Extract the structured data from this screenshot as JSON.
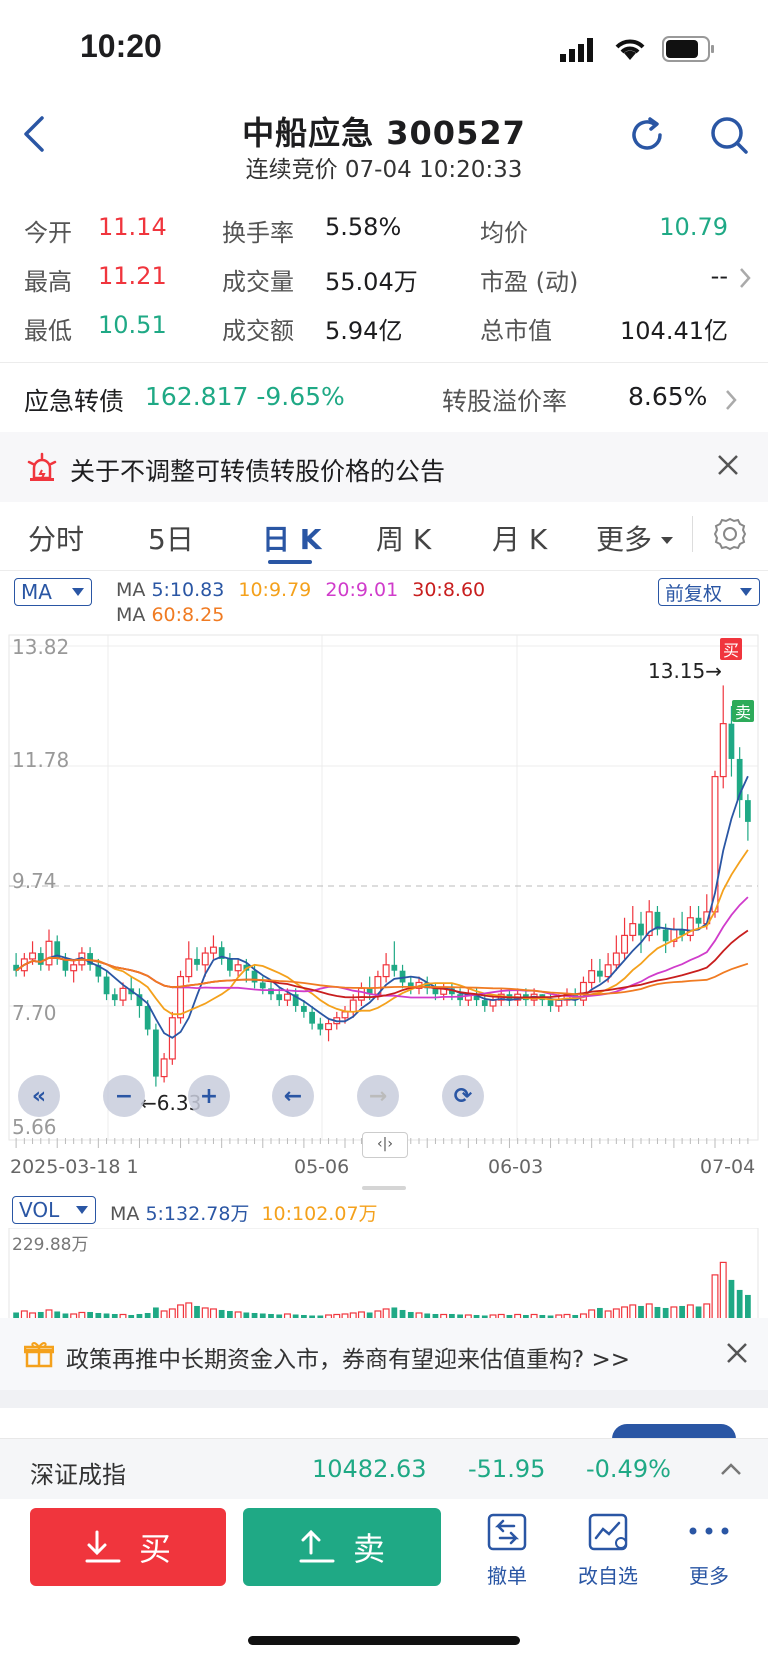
{
  "status": {
    "time": "10:20"
  },
  "header": {
    "title": "中船应急 300527",
    "subtitle": "连续竞价 07-04 10:20:33"
  },
  "quote": {
    "open_label": "今开",
    "open": "11.14",
    "high_label": "最高",
    "high": "11.21",
    "low_label": "最低",
    "low": "10.51",
    "turnover_label": "换手率",
    "turnover": "5.58%",
    "volume_label": "成交量",
    "volume": "55.04万",
    "amount_label": "成交额",
    "amount": "5.94亿",
    "avg_label": "均价",
    "avg": "10.79",
    "pe_label": "市盈 (动)",
    "pe": "--",
    "mcap_label": "总市值",
    "mcap": "104.41亿"
  },
  "bond": {
    "label": "应急转债",
    "value": "162.817 -9.65%",
    "premium_label": "转股溢价率",
    "premium": "8.65%"
  },
  "notice": {
    "text": "关于不调整可转债转股价格的公告"
  },
  "tabs": {
    "t1": "分时",
    "t2": "5日",
    "t3": "日 K",
    "t4": "周 K",
    "t5": "月 K",
    "t6": "更多"
  },
  "ma": {
    "selector": "MA",
    "prefix": "MA",
    "ma5": "5:10.83",
    "ma10": "10:9.79",
    "ma20": "20:9.01",
    "ma30": "30:8.60",
    "prefix2": "MA",
    "ma60": "60:8.25",
    "adjust": "前复权"
  },
  "chart_labels": {
    "y1": "13.82",
    "y2": "11.78",
    "y3": "9.74",
    "y4": "7.70",
    "y5": "5.66",
    "max_label": "13.15→",
    "min_label": "←6.33",
    "buy_tag": "买",
    "sell_tag": "卖",
    "d1": "2025-03-18 1",
    "d2": "05-06",
    "d3": "06-03",
    "d4": "07-04"
  },
  "vol": {
    "selector": "VOL",
    "prefix": "MA",
    "ma5": "5:132.78万",
    "ma10": "10:102.07万",
    "max": "229.88万"
  },
  "promo": {
    "text": "政策再推中长期资金入市，券商有望迎来估值重构? >>"
  },
  "index": {
    "name": "深证成指",
    "value": "10482.63",
    "change": "-51.95",
    "pct": "-0.49%"
  },
  "actions": {
    "buy": "买",
    "sell": "卖",
    "cancel": "撤单",
    "watch": "改自选",
    "more": "更多"
  },
  "colors": {
    "up": "#f0353d",
    "down": "#1fa985",
    "accent": "#2a56a4"
  },
  "chart_data": {
    "type": "candlestick",
    "ylim": [
      5.66,
      13.82
    ],
    "annotations": {
      "max": 13.15,
      "min": 6.33
    },
    "candles": [
      [
        8.4,
        8.3,
        8.6,
        8.2
      ],
      [
        8.3,
        8.5,
        8.6,
        8.2
      ],
      [
        8.5,
        8.6,
        8.8,
        8.4
      ],
      [
        8.6,
        8.4,
        8.7,
        8.3
      ],
      [
        8.4,
        8.8,
        9.0,
        8.3
      ],
      [
        8.8,
        8.5,
        8.9,
        8.4
      ],
      [
        8.5,
        8.3,
        8.6,
        8.2
      ],
      [
        8.3,
        8.4,
        8.5,
        8.1
      ],
      [
        8.4,
        8.6,
        8.7,
        8.3
      ],
      [
        8.6,
        8.4,
        8.7,
        8.3
      ],
      [
        8.4,
        8.2,
        8.5,
        8.1
      ],
      [
        8.2,
        7.9,
        8.3,
        7.8
      ],
      [
        7.9,
        7.8,
        8.0,
        7.7
      ],
      [
        7.8,
        8.0,
        8.1,
        7.7
      ],
      [
        8.0,
        7.9,
        8.2,
        7.8
      ],
      [
        7.9,
        7.7,
        8.0,
        7.5
      ],
      [
        7.7,
        7.3,
        7.8,
        7.2
      ],
      [
        7.3,
        6.5,
        7.4,
        6.33
      ],
      [
        6.5,
        6.8,
        6.9,
        6.4
      ],
      [
        6.8,
        7.5,
        7.6,
        6.7
      ],
      [
        7.5,
        8.2,
        8.3,
        7.4
      ],
      [
        8.2,
        8.5,
        8.8,
        8.1
      ],
      [
        8.5,
        8.4,
        8.7,
        8.3
      ],
      [
        8.4,
        8.6,
        8.7,
        8.2
      ],
      [
        8.6,
        8.7,
        8.9,
        8.5
      ],
      [
        8.7,
        8.5,
        8.8,
        8.4
      ],
      [
        8.5,
        8.3,
        8.6,
        8.2
      ],
      [
        8.3,
        8.4,
        8.5,
        8.2
      ],
      [
        8.4,
        8.3,
        8.5,
        8.1
      ],
      [
        8.3,
        8.1,
        8.4,
        8.0
      ],
      [
        8.1,
        8.0,
        8.2,
        7.9
      ],
      [
        8.0,
        7.9,
        8.1,
        7.8
      ],
      [
        7.9,
        7.8,
        8.0,
        7.7
      ],
      [
        7.8,
        7.9,
        8.0,
        7.7
      ],
      [
        7.9,
        7.7,
        8.0,
        7.6
      ],
      [
        7.7,
        7.6,
        7.8,
        7.5
      ],
      [
        7.6,
        7.4,
        7.7,
        7.3
      ],
      [
        7.4,
        7.3,
        7.5,
        7.2
      ],
      [
        7.3,
        7.4,
        7.5,
        7.1
      ],
      [
        7.4,
        7.5,
        7.6,
        7.3
      ],
      [
        7.5,
        7.6,
        7.7,
        7.4
      ],
      [
        7.6,
        7.8,
        7.9,
        7.5
      ],
      [
        7.8,
        8.0,
        8.1,
        7.7
      ],
      [
        8.0,
        7.9,
        8.2,
        7.8
      ],
      [
        7.9,
        8.2,
        8.3,
        7.8
      ],
      [
        8.2,
        8.4,
        8.6,
        8.1
      ],
      [
        8.4,
        8.3,
        8.8,
        8.2
      ],
      [
        8.3,
        8.1,
        8.4,
        8.0
      ],
      [
        8.1,
        8.0,
        8.2,
        7.9
      ],
      [
        8.0,
        8.1,
        8.2,
        7.9
      ],
      [
        8.1,
        8.0,
        8.2,
        7.9
      ],
      [
        8.0,
        7.9,
        8.1,
        7.8
      ],
      [
        7.9,
        8.0,
        8.1,
        7.8
      ],
      [
        8.0,
        7.9,
        8.1,
        7.8
      ],
      [
        7.9,
        7.8,
        8.0,
        7.7
      ],
      [
        7.8,
        7.9,
        8.0,
        7.7
      ],
      [
        7.9,
        7.8,
        8.0,
        7.7
      ],
      [
        7.8,
        7.7,
        7.9,
        7.6
      ],
      [
        7.7,
        7.8,
        7.9,
        7.6
      ],
      [
        7.8,
        7.9,
        8.0,
        7.7
      ],
      [
        7.9,
        7.8,
        8.0,
        7.7
      ],
      [
        7.8,
        7.9,
        8.0,
        7.7
      ],
      [
        7.9,
        7.8,
        8.0,
        7.7
      ],
      [
        7.8,
        7.9,
        8.0,
        7.7
      ],
      [
        7.9,
        7.8,
        7.9,
        7.7
      ],
      [
        7.8,
        7.7,
        7.9,
        7.6
      ],
      [
        7.7,
        7.8,
        7.9,
        7.6
      ],
      [
        7.8,
        7.9,
        8.0,
        7.7
      ],
      [
        7.9,
        7.8,
        8.0,
        7.7
      ],
      [
        7.8,
        8.1,
        8.2,
        7.7
      ],
      [
        8.1,
        8.3,
        8.5,
        8.0
      ],
      [
        8.3,
        8.2,
        8.5,
        8.1
      ],
      [
        8.2,
        8.4,
        8.6,
        8.1
      ],
      [
        8.4,
        8.6,
        8.9,
        8.3
      ],
      [
        8.6,
        8.9,
        9.2,
        8.5
      ],
      [
        8.9,
        9.1,
        9.4,
        8.8
      ],
      [
        9.1,
        8.9,
        9.3,
        8.6
      ],
      [
        8.9,
        9.3,
        9.5,
        8.8
      ],
      [
        9.3,
        9.0,
        9.4,
        8.9
      ],
      [
        9.0,
        8.8,
        9.1,
        8.6
      ],
      [
        8.8,
        9.0,
        9.2,
        8.7
      ],
      [
        9.0,
        8.9,
        9.3,
        8.8
      ],
      [
        8.9,
        9.2,
        9.4,
        8.8
      ],
      [
        9.2,
        9.1,
        9.4,
        9.0
      ],
      [
        9.1,
        9.3,
        9.6,
        9.0
      ],
      [
        9.3,
        11.6,
        11.7,
        9.2
      ],
      [
        11.6,
        12.5,
        13.15,
        11.4
      ],
      [
        12.5,
        11.9,
        12.8,
        11.6
      ],
      [
        11.9,
        11.2,
        12.1,
        10.9
      ],
      [
        11.2,
        10.83,
        11.3,
        10.51
      ]
    ],
    "volumes": [
      15,
      18,
      14,
      16,
      20,
      17,
      13,
      12,
      15,
      16,
      14,
      13,
      12,
      11,
      10,
      12,
      14,
      25,
      18,
      22,
      30,
      34,
      28,
      24,
      22,
      20,
      18,
      16,
      15,
      14,
      13,
      12,
      11,
      12,
      11,
      10,
      9,
      9,
      10,
      11,
      12,
      14,
      16,
      15,
      18,
      22,
      25,
      20,
      16,
      14,
      13,
      12,
      11,
      12,
      11,
      10,
      10,
      9,
      10,
      11,
      10,
      11,
      10,
      11,
      10,
      9,
      10,
      11,
      10,
      12,
      20,
      24,
      18,
      22,
      26,
      30,
      28,
      32,
      26,
      24,
      26,
      28,
      30,
      27,
      32,
      90,
      120,
      80,
      60,
      50
    ]
  }
}
